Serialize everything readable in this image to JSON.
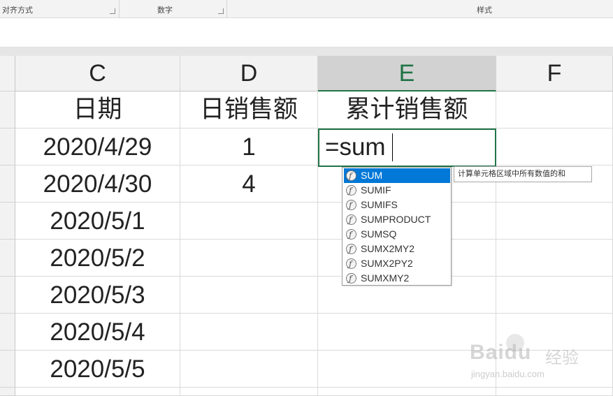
{
  "ribbon": {
    "groups": [
      "对齐方式",
      "数字",
      "样式"
    ]
  },
  "columns": [
    "C",
    "D",
    "E",
    "F"
  ],
  "active_column": "E",
  "headers": {
    "date": "日期",
    "daily_sales": "日销售额",
    "cumulative_sales": "累计销售额"
  },
  "rows": [
    {
      "date": "2020/4/29",
      "sales": "1"
    },
    {
      "date": "2020/4/30",
      "sales": "4"
    },
    {
      "date": "2020/5/1",
      "sales": ""
    },
    {
      "date": "2020/5/2",
      "sales": ""
    },
    {
      "date": "2020/5/3",
      "sales": ""
    },
    {
      "date": "2020/5/4",
      "sales": ""
    },
    {
      "date": "2020/5/5",
      "sales": ""
    }
  ],
  "active_cell": {
    "value": "=sum"
  },
  "autocomplete": {
    "items": [
      "SUM",
      "SUMIF",
      "SUMIFS",
      "SUMPRODUCT",
      "SUMSQ",
      "SUMX2MY2",
      "SUMX2PY2",
      "SUMXMY2"
    ],
    "selected": "SUM",
    "tooltip": "计算单元格区域中所有数值的和"
  },
  "watermark": {
    "brand": "Baidu",
    "product": "经验",
    "url": "jingyan.baidu.com"
  },
  "colors": {
    "accent": "#217346",
    "highlight": "#0078d7"
  }
}
